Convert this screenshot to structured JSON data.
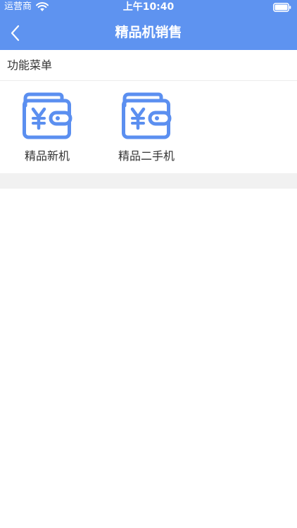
{
  "status_bar": {
    "carrier": "运营商",
    "time": "上午10:40"
  },
  "nav": {
    "title": "精品机销售",
    "back_icon": "chevron-left-icon"
  },
  "section": {
    "title": "功能菜单"
  },
  "menu": {
    "items": [
      {
        "label": "精品新机",
        "icon": "yen-wallet-icon"
      },
      {
        "label": "精品二手机",
        "icon": "yen-wallet-icon"
      }
    ]
  },
  "colors": {
    "header": "#5e93f0",
    "icon": "#5b8ff0",
    "divider": "#f1f1f1"
  }
}
